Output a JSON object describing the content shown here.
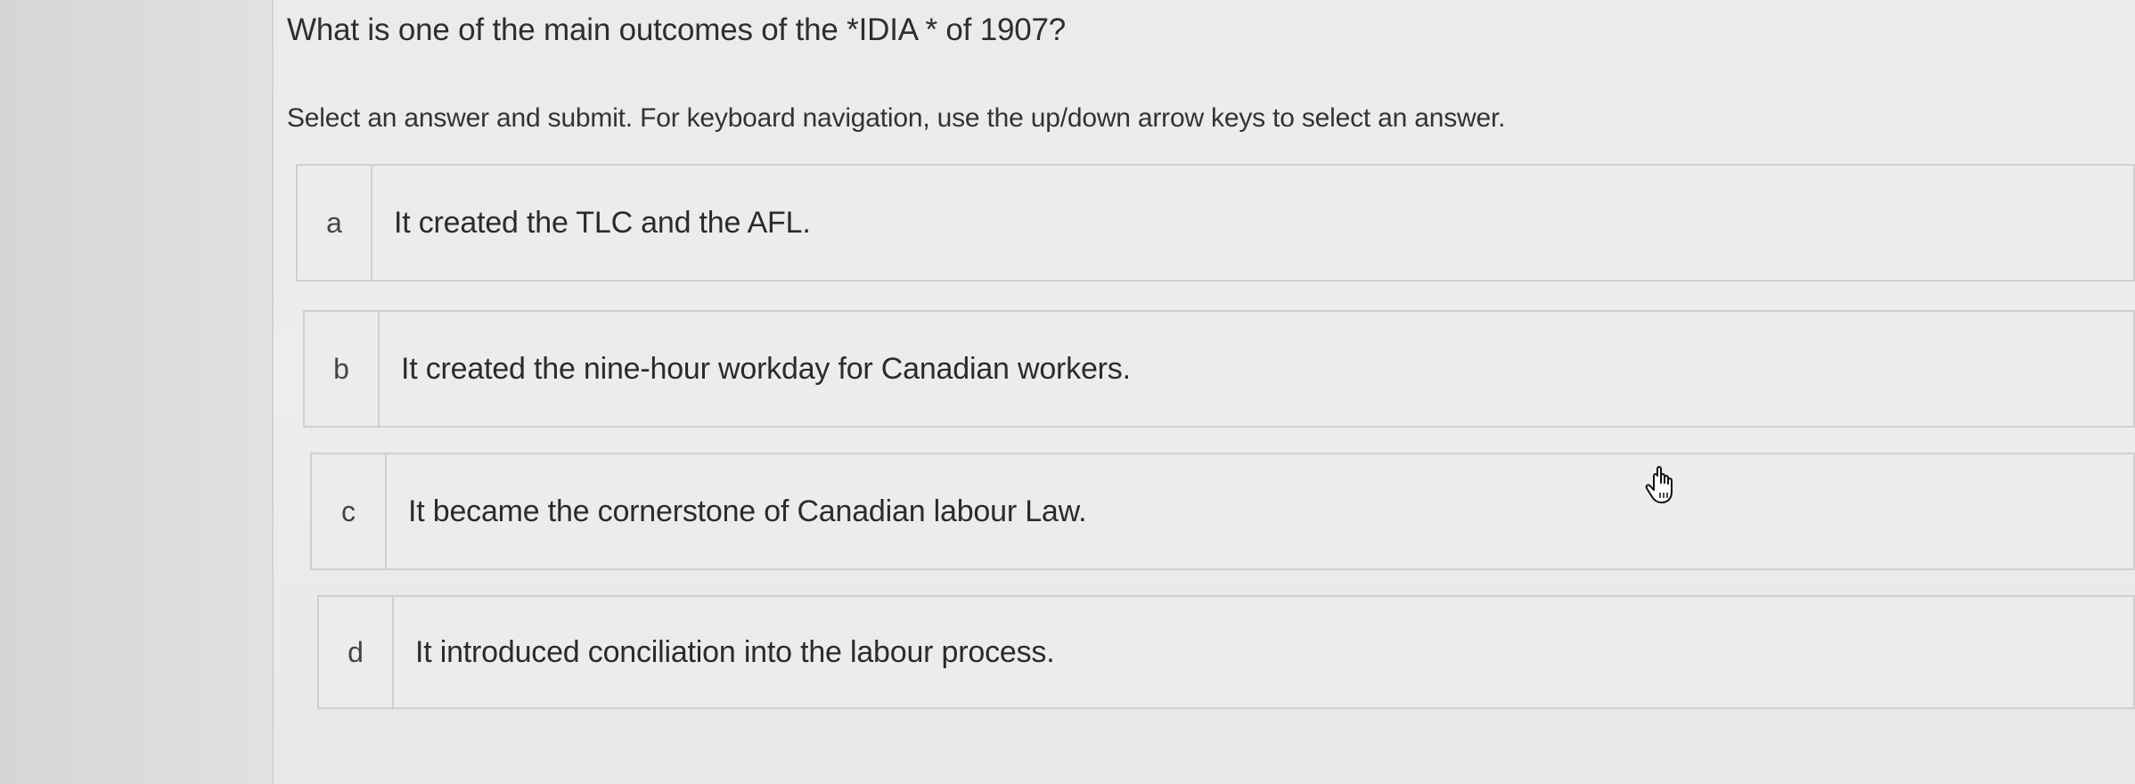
{
  "question": {
    "text": "What is one of the main outcomes of the *IDIA * of 1907?"
  },
  "instructions": "Select an answer and submit. For keyboard navigation, use the up/down arrow keys to select an answer.",
  "options": [
    {
      "letter": "a",
      "text": "It created the TLC and the AFL."
    },
    {
      "letter": "b",
      "text": "It created the nine-hour workday for Canadian workers."
    },
    {
      "letter": "c",
      "text": "It became the cornerstone of Canadian labour Law."
    },
    {
      "letter": "d",
      "text": "It introduced conciliation into the labour process."
    }
  ],
  "cursor": {
    "icon": "hand-pointer-icon"
  }
}
